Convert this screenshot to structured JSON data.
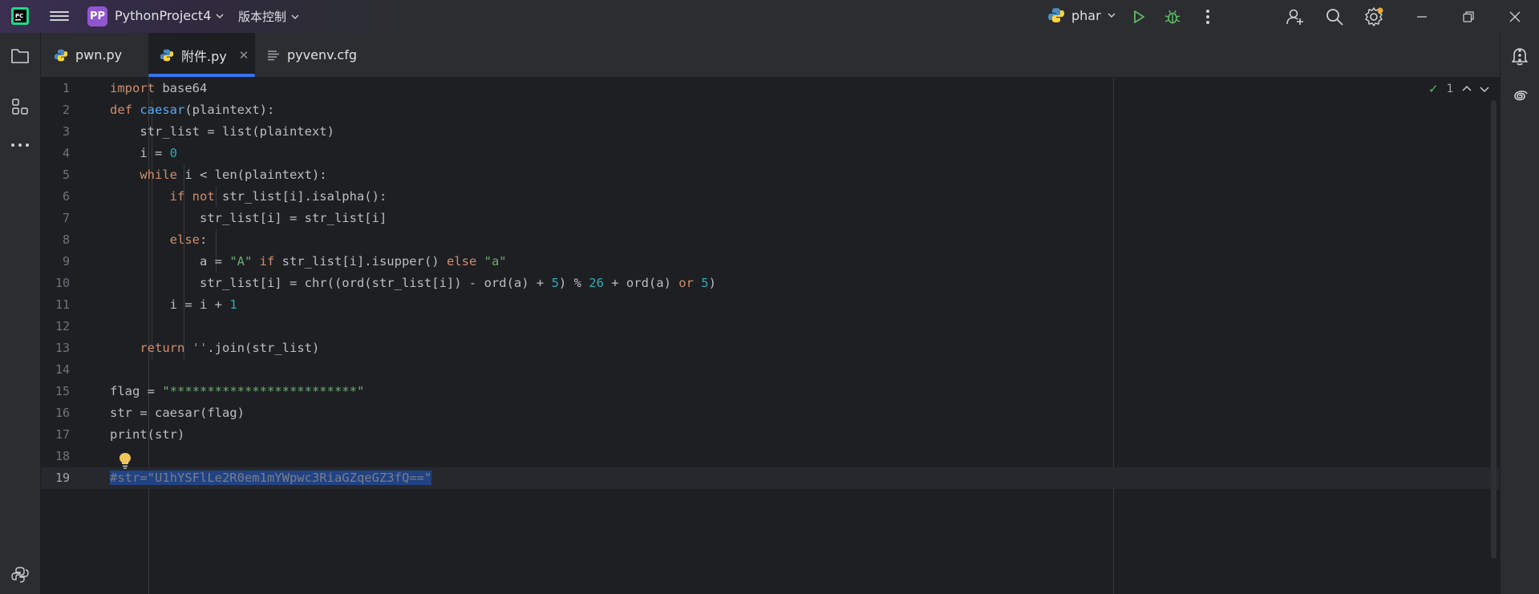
{
  "titlebar": {
    "project_badge": "PP",
    "project_name": "PythonProject4",
    "vcs_label": "版本控制",
    "run_config": "phar",
    "accent_color": "#9155d1"
  },
  "tabs": [
    {
      "label": "pwn.py",
      "icon": "python-file-icon"
    },
    {
      "label": "附件.py",
      "icon": "python-file-icon",
      "active": true
    },
    {
      "label": "pyvenv.cfg",
      "icon": "text-file-icon"
    }
  ],
  "editor": {
    "line_numbers": [
      "1",
      "2",
      "3",
      "4",
      "5",
      "6",
      "7",
      "8",
      "9",
      "10",
      "11",
      "12",
      "13",
      "14",
      "15",
      "16",
      "17",
      "18",
      "19"
    ],
    "current_line": "19",
    "inspection_count": "1",
    "code_lines": [
      "import base64",
      "def caesar(plaintext):",
      "    str_list = list(plaintext)",
      "    i = 0",
      "    while i < len(plaintext):",
      "        if not str_list[i].isalpha():",
      "            str_list[i] = str_list[i]",
      "        else:",
      "            a = \"A\" if str_list[i].isupper() else \"a\"",
      "            str_list[i] = chr((ord(str_list[i]) - ord(a) + 5) % 26 + ord(a) or 5)",
      "        i = i + 1",
      "",
      "    return ''.join(str_list)",
      "",
      "flag = \"*************************\"",
      "str = caesar(flag)",
      "print(str)",
      "",
      "#str=\"U1hYSFlLe2R0em1mYWpwc3RiaGZqeGZ3fQ==\""
    ]
  },
  "colors": {
    "background": "#1e1f22",
    "panel": "#2b2d30",
    "keyword": "#cf8e6d",
    "function": "#56a8f5",
    "number": "#2aacb8",
    "string": "#6aab73",
    "comment": "#7a7e85",
    "selection": "#214283",
    "tab_underline": "#3574f0"
  }
}
